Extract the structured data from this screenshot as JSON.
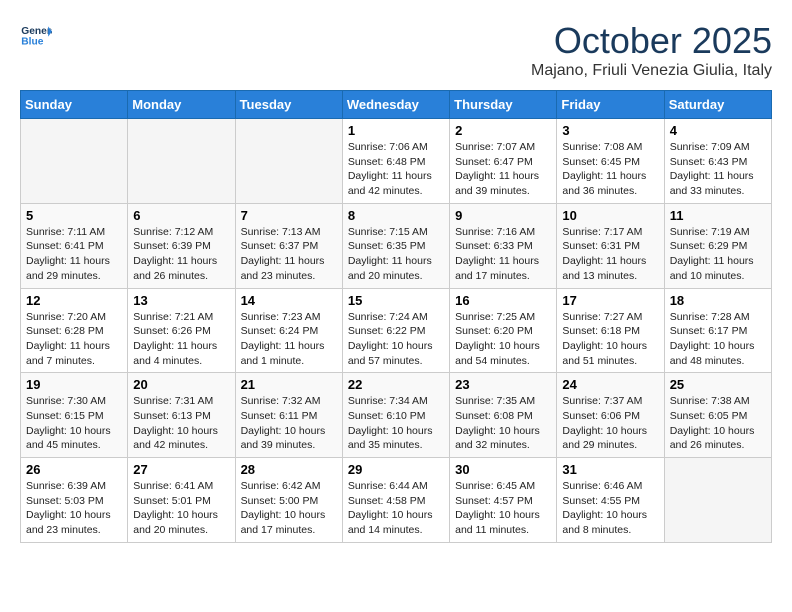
{
  "header": {
    "logo_line1": "General",
    "logo_line2": "Blue",
    "month": "October 2025",
    "location": "Majano, Friuli Venezia Giulia, Italy"
  },
  "weekdays": [
    "Sunday",
    "Monday",
    "Tuesday",
    "Wednesday",
    "Thursday",
    "Friday",
    "Saturday"
  ],
  "weeks": [
    [
      {
        "day": "",
        "empty": true
      },
      {
        "day": "",
        "empty": true
      },
      {
        "day": "",
        "empty": true
      },
      {
        "day": "1",
        "sunrise": "7:06 AM",
        "sunset": "6:48 PM",
        "daylight": "11 hours and 42 minutes."
      },
      {
        "day": "2",
        "sunrise": "7:07 AM",
        "sunset": "6:47 PM",
        "daylight": "11 hours and 39 minutes."
      },
      {
        "day": "3",
        "sunrise": "7:08 AM",
        "sunset": "6:45 PM",
        "daylight": "11 hours and 36 minutes."
      },
      {
        "day": "4",
        "sunrise": "7:09 AM",
        "sunset": "6:43 PM",
        "daylight": "11 hours and 33 minutes."
      }
    ],
    [
      {
        "day": "5",
        "sunrise": "7:11 AM",
        "sunset": "6:41 PM",
        "daylight": "11 hours and 29 minutes."
      },
      {
        "day": "6",
        "sunrise": "7:12 AM",
        "sunset": "6:39 PM",
        "daylight": "11 hours and 26 minutes."
      },
      {
        "day": "7",
        "sunrise": "7:13 AM",
        "sunset": "6:37 PM",
        "daylight": "11 hours and 23 minutes."
      },
      {
        "day": "8",
        "sunrise": "7:15 AM",
        "sunset": "6:35 PM",
        "daylight": "11 hours and 20 minutes."
      },
      {
        "day": "9",
        "sunrise": "7:16 AM",
        "sunset": "6:33 PM",
        "daylight": "11 hours and 17 minutes."
      },
      {
        "day": "10",
        "sunrise": "7:17 AM",
        "sunset": "6:31 PM",
        "daylight": "11 hours and 13 minutes."
      },
      {
        "day": "11",
        "sunrise": "7:19 AM",
        "sunset": "6:29 PM",
        "daylight": "11 hours and 10 minutes."
      }
    ],
    [
      {
        "day": "12",
        "sunrise": "7:20 AM",
        "sunset": "6:28 PM",
        "daylight": "11 hours and 7 minutes."
      },
      {
        "day": "13",
        "sunrise": "7:21 AM",
        "sunset": "6:26 PM",
        "daylight": "11 hours and 4 minutes."
      },
      {
        "day": "14",
        "sunrise": "7:23 AM",
        "sunset": "6:24 PM",
        "daylight": "11 hours and 1 minute."
      },
      {
        "day": "15",
        "sunrise": "7:24 AM",
        "sunset": "6:22 PM",
        "daylight": "10 hours and 57 minutes."
      },
      {
        "day": "16",
        "sunrise": "7:25 AM",
        "sunset": "6:20 PM",
        "daylight": "10 hours and 54 minutes."
      },
      {
        "day": "17",
        "sunrise": "7:27 AM",
        "sunset": "6:18 PM",
        "daylight": "10 hours and 51 minutes."
      },
      {
        "day": "18",
        "sunrise": "7:28 AM",
        "sunset": "6:17 PM",
        "daylight": "10 hours and 48 minutes."
      }
    ],
    [
      {
        "day": "19",
        "sunrise": "7:30 AM",
        "sunset": "6:15 PM",
        "daylight": "10 hours and 45 minutes."
      },
      {
        "day": "20",
        "sunrise": "7:31 AM",
        "sunset": "6:13 PM",
        "daylight": "10 hours and 42 minutes."
      },
      {
        "day": "21",
        "sunrise": "7:32 AM",
        "sunset": "6:11 PM",
        "daylight": "10 hours and 39 minutes."
      },
      {
        "day": "22",
        "sunrise": "7:34 AM",
        "sunset": "6:10 PM",
        "daylight": "10 hours and 35 minutes."
      },
      {
        "day": "23",
        "sunrise": "7:35 AM",
        "sunset": "6:08 PM",
        "daylight": "10 hours and 32 minutes."
      },
      {
        "day": "24",
        "sunrise": "7:37 AM",
        "sunset": "6:06 PM",
        "daylight": "10 hours and 29 minutes."
      },
      {
        "day": "25",
        "sunrise": "7:38 AM",
        "sunset": "6:05 PM",
        "daylight": "10 hours and 26 minutes."
      }
    ],
    [
      {
        "day": "26",
        "sunrise": "6:39 AM",
        "sunset": "5:03 PM",
        "daylight": "10 hours and 23 minutes."
      },
      {
        "day": "27",
        "sunrise": "6:41 AM",
        "sunset": "5:01 PM",
        "daylight": "10 hours and 20 minutes."
      },
      {
        "day": "28",
        "sunrise": "6:42 AM",
        "sunset": "5:00 PM",
        "daylight": "10 hours and 17 minutes."
      },
      {
        "day": "29",
        "sunrise": "6:44 AM",
        "sunset": "4:58 PM",
        "daylight": "10 hours and 14 minutes."
      },
      {
        "day": "30",
        "sunrise": "6:45 AM",
        "sunset": "4:57 PM",
        "daylight": "10 hours and 11 minutes."
      },
      {
        "day": "31",
        "sunrise": "6:46 AM",
        "sunset": "4:55 PM",
        "daylight": "10 hours and 8 minutes."
      },
      {
        "day": "",
        "empty": true
      }
    ]
  ],
  "labels": {
    "sunrise": "Sunrise:",
    "sunset": "Sunset:",
    "daylight": "Daylight:"
  }
}
